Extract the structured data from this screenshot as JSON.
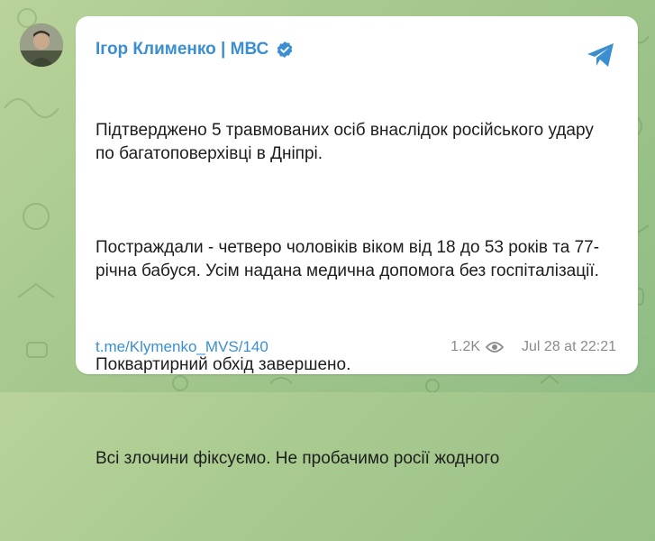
{
  "post": {
    "author": "Ігор Клименко | МВС",
    "paragraphs": [
      "Підтверджено 5 травмованих осіб внаслідок російського удару по багатоповерхівці в Дніпрі.",
      "Постраждали - четверо чоловіків віком від 18 до 53 років та 77-річна бабуся. Усім надана медична допомога без госпіталізації.",
      "Поквартирний обхід завершено.",
      "Всі злочини фіксуємо. Не пробачимо росії жодного"
    ],
    "link": "t.me/Klymenko_MVS/140",
    "views": "1.2K",
    "timestamp": "Jul 28 at 22:21"
  },
  "icons": {
    "verified": "verified-badge-icon",
    "share": "share-arrow-icon",
    "views": "eye-icon"
  },
  "colors": {
    "accent": "#3b8fd0",
    "background": "#a8ca8f"
  }
}
